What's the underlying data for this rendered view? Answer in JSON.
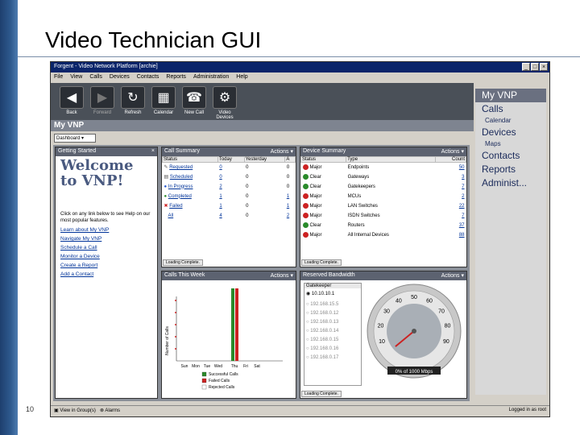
{
  "slide": {
    "title": "Video Technician GUI",
    "page_number": "10"
  },
  "window": {
    "title": "Forgent - Video Network Platform [archie]",
    "controls": [
      "_",
      "□",
      "×"
    ]
  },
  "menu": [
    "File",
    "View",
    "Calls",
    "Devices",
    "Contacts",
    "Reports",
    "Administration",
    "Help"
  ],
  "toolbar": [
    {
      "label": "Back",
      "icon": "arrow-left-icon"
    },
    {
      "label": "Forward",
      "icon": "arrow-right-icon"
    },
    {
      "label": "Refresh",
      "icon": "refresh-icon"
    },
    {
      "label": "Calendar",
      "icon": "calendar-icon"
    },
    {
      "label": "New Call",
      "icon": "new-call-icon"
    },
    {
      "label": "Video Devices",
      "icon": "video-devices-icon"
    }
  ],
  "header": "My VNP",
  "view_select": "Dashboard",
  "getting_started": {
    "title": "Getting Started",
    "close": "×",
    "welcome_line1": "Welcome",
    "welcome_line2": "to VNP!",
    "intro": "Click on any link below to see Help on our most popular features.",
    "links": [
      "Learn about My VNP",
      "Navigate My VNP",
      "Schedule a Call",
      "Monitor a Device",
      "Create a Report",
      "Add a Contact"
    ]
  },
  "call_summary": {
    "title": "Call Summary",
    "actions": "Actions ▾",
    "columns": [
      "Status",
      "Today",
      "Yesterday",
      "A"
    ],
    "rows": [
      {
        "status": "Requested",
        "today": "0",
        "yesterday": "0",
        "a": "0"
      },
      {
        "status": "Scheduled",
        "today": "0",
        "yesterday": "0",
        "a": "0"
      },
      {
        "status": "In Progress",
        "today": "2",
        "yesterday": "0",
        "a": "0"
      },
      {
        "status": "Completed",
        "today": "1",
        "yesterday": "0",
        "a": "1"
      },
      {
        "status": "Failed",
        "today": "1",
        "yesterday": "0",
        "a": "1"
      },
      {
        "status": "All",
        "today": "4",
        "yesterday": "0",
        "a": "2"
      }
    ],
    "status": "Loading Complete."
  },
  "device_summary": {
    "title": "Device Summary",
    "actions": "Actions ▾",
    "columns": [
      "Status",
      "Type",
      "Count"
    ],
    "rows": [
      {
        "status": "Major",
        "type": "Endpoints",
        "count": "50"
      },
      {
        "status": "Clear",
        "type": "Gateways",
        "count": "3"
      },
      {
        "status": "Clear",
        "type": "Gatekeepers",
        "count": "7"
      },
      {
        "status": "Major",
        "type": "MCUs",
        "count": "2"
      },
      {
        "status": "Major",
        "type": "LAN Switches",
        "count": "22"
      },
      {
        "status": "Major",
        "type": "ISDN Switches",
        "count": "7"
      },
      {
        "status": "Clear",
        "type": "Routers",
        "count": "37"
      },
      {
        "status": "Major",
        "type": "All Internal Devices",
        "count": "88"
      }
    ],
    "status": "Loading Complete."
  },
  "calls_this_week": {
    "title": "Calls This Week",
    "actions": "Actions ▾",
    "ylabel": "Number of Calls",
    "categories": [
      "Sun",
      "Mon",
      "Tue",
      "Wed",
      "Thu",
      "Fri",
      "Sat"
    ],
    "legend": [
      "Successful Calls",
      "Failed Calls",
      "Rejected Calls"
    ],
    "colors": [
      "#2a8a2a",
      "#cc2222",
      "#ffffff"
    ]
  },
  "bandwidth": {
    "title": "Reserved Bandwidth",
    "actions": "Actions ▾",
    "column": "Gatekeeper",
    "items": [
      "10.10.10.1",
      "192.168.15.5",
      "192.168.0.12",
      "192.168.0.13",
      "192.168.0.14",
      "192.168.0.15",
      "192.168.0.16",
      "192.168.0.17"
    ],
    "gauge_ticks": [
      "10",
      "20",
      "30",
      "40",
      "50",
      "60",
      "70",
      "80",
      "90"
    ],
    "gauge_value_fraction": 0.02,
    "gauge_text": "0% of 1000 Mbps",
    "status": "Loading Complete."
  },
  "right_nav": [
    {
      "label": "My VNP",
      "level": "head"
    },
    {
      "label": "Calls",
      "level": 1
    },
    {
      "label": "Calendar",
      "level": 2
    },
    {
      "label": "Devices",
      "level": 1
    },
    {
      "label": "Maps",
      "level": 2
    },
    {
      "label": "Contacts",
      "level": 1
    },
    {
      "label": "Reports",
      "level": 1
    },
    {
      "label": "Administ...",
      "level": 1
    }
  ],
  "statusbar": {
    "view": "View in Group(s)",
    "alarms": "Alarms",
    "user": "Logged in as root"
  }
}
